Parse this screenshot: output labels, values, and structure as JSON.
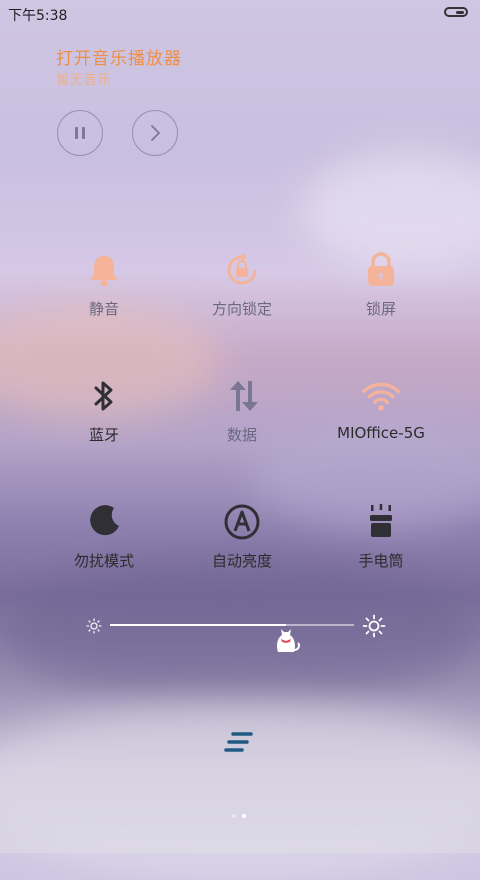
{
  "status_bar": {
    "time": "下午5:38"
  },
  "music": {
    "title": "打开音乐播放器",
    "subtitle": "暂无音乐"
  },
  "toggles": [
    {
      "label": "静音",
      "icon": "bell-icon",
      "state": "off"
    },
    {
      "label": "方向锁定",
      "icon": "orientation-lock-icon",
      "state": "off"
    },
    {
      "label": "锁屏",
      "icon": "lock-icon",
      "state": "off"
    },
    {
      "label": "蓝牙",
      "icon": "bluetooth-icon",
      "state": "on"
    },
    {
      "label": "数据",
      "icon": "mobile-data-icon",
      "state": "off"
    },
    {
      "label": "MIOffice-5G",
      "icon": "wifi-icon",
      "state": "on"
    },
    {
      "label": "勿扰模式",
      "icon": "moon-icon",
      "state": "on"
    },
    {
      "label": "自动亮度",
      "icon": "auto-brightness-icon",
      "state": "on"
    },
    {
      "label": "手电筒",
      "icon": "flashlight-icon",
      "state": "off"
    }
  ],
  "brightness": {
    "level": 0.72
  },
  "colors": {
    "accent": "#ef8f46",
    "icon_on": "#2f2f35",
    "icon_off_warm": "#f5b49a",
    "icon_off_gray": "#7a7694"
  }
}
